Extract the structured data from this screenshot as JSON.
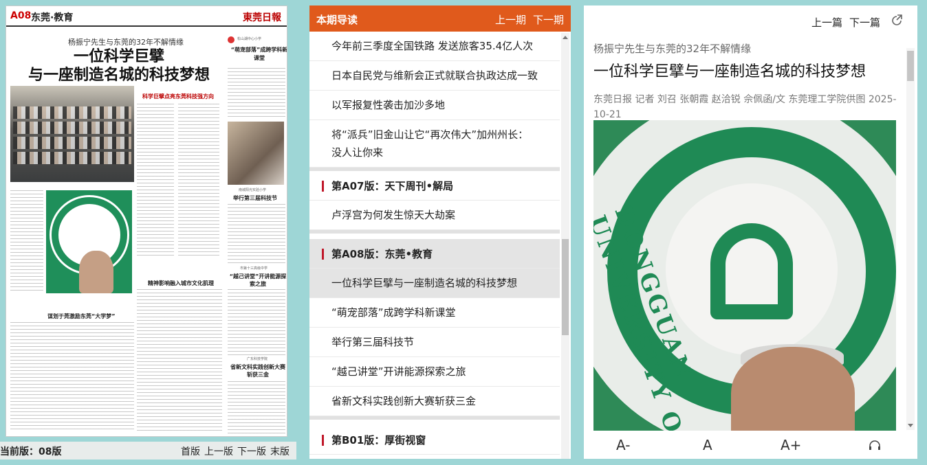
{
  "paper": {
    "page_code": "A08",
    "section": "东莞·教育",
    "masthead": "東莞日報",
    "kicker": "杨振宁先生与东莞的32年不解情缘",
    "headline_line1": "一位科学巨擘",
    "headline_line2": "与一座制造名城的科技梦想",
    "sub_a": "科学巨擘点亮东莞科技强方向",
    "sub_b": "精神影响融入城市文化肌理",
    "sub_c": "谋划于莞激励东莞“大学梦”",
    "side_1_kicker": "松山湖中心小学",
    "side_1_title": "“萌宠部落”成跨学科新课堂",
    "side_2_kicker": "南城阳光实验小学",
    "side_2_title": "举行第三届科技节",
    "side_3_kicker": "市第十三高级中学",
    "side_3_title": "“越己讲堂”开讲能源探索之旅",
    "side_4_kicker": "广东科技学院",
    "side_4_title": "省新文科实践创新大赛斩获三金"
  },
  "pagebar": {
    "current": "当前版：08版",
    "first": "首版",
    "prev": "上一版",
    "next": "下一版",
    "last": "末版"
  },
  "guide": {
    "title": "本期导读",
    "prev": "上一期",
    "next": "下一期",
    "group_a": [
      "今年前三季度全国铁路 发送旅客35.4亿人次",
      "日本自民党与维新会正式就联合执政达成一致",
      "以军报复性袭击加沙多地",
      "将“派兵”旧金山让它“再次伟大”加州州长：没人让你来"
    ],
    "section_a07": "第A07版：天下周刊•解局",
    "group_a07": [
      "卢浮宫为何发生惊天大劫案"
    ],
    "section_a08": "第A08版：东莞•教育",
    "group_a08": [
      "一位科学巨擘与一座制造名城的科技梦想",
      "“萌宠部落”成跨学科新课堂",
      "举行第三届科技节",
      "“越己讲堂”开讲能源探索之旅",
      "省新文科实践创新大赛斩获三金"
    ],
    "section_b01": "第B01版：厚街视窗"
  },
  "reader": {
    "prev": "上一篇",
    "next": "下一篇",
    "kicker": "杨振宁先生与东莞的32年不解情缘",
    "title": "一位科学巨擘与一座制造名城的科技梦想",
    "byline": "东莞日报 记者 刘召 张朝霞 赵洽锐 佘佩函/文 东莞理工学院供图 2025-10-21",
    "photo_text": "DONGGUAN UNIVERSITY OF TE",
    "font_smaller": "A-",
    "font_normal": "A",
    "font_larger": "A+"
  }
}
